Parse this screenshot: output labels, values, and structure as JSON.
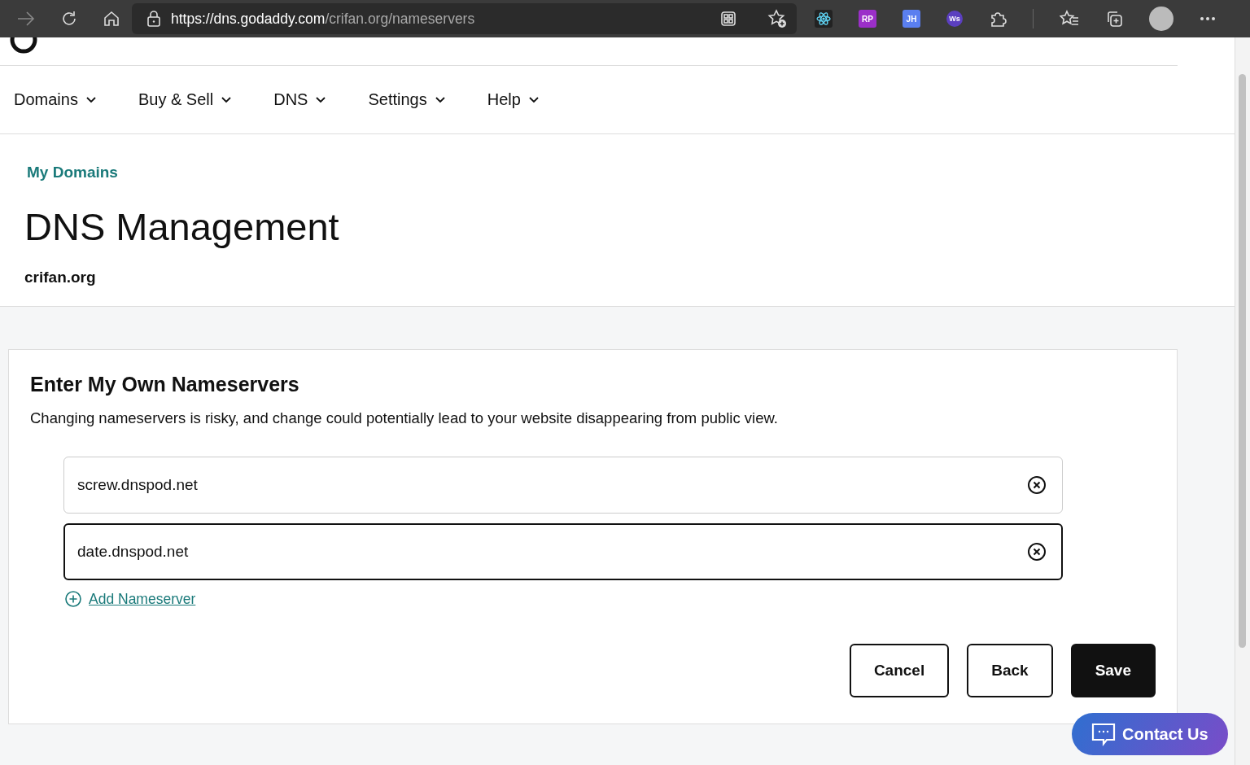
{
  "browser": {
    "url_host": "https://dns.godaddy.com",
    "url_path": "/crifan.org/nameservers",
    "extensions": [
      {
        "kind": "react"
      },
      {
        "kind": "badge",
        "label": "RP",
        "color": "#9b2fc9"
      },
      {
        "kind": "badge",
        "label": "JH",
        "color": "#5a7ff0"
      },
      {
        "kind": "round",
        "label": "Ws",
        "color": "#5b3fc0"
      }
    ]
  },
  "nav": {
    "items": [
      {
        "label": "Domains"
      },
      {
        "label": "Buy & Sell"
      },
      {
        "label": "DNS"
      },
      {
        "label": "Settings"
      },
      {
        "label": "Help"
      }
    ]
  },
  "header": {
    "breadcrumb": "My Domains",
    "title": "DNS Management",
    "domain": "crifan.org"
  },
  "card": {
    "title": "Enter My Own Nameservers",
    "description": "Changing nameservers is risky, and change could potentially lead to your website disappearing from public view.",
    "nameservers": [
      {
        "value": "screw.dnspod.net",
        "focused": false
      },
      {
        "value": "date.dnspod.net",
        "focused": true
      }
    ],
    "add_link": "Add Nameserver",
    "buttons": [
      {
        "label": "Cancel",
        "kind": "secondary"
      },
      {
        "label": "Back",
        "kind": "secondary"
      },
      {
        "label": "Save",
        "kind": "primary"
      }
    ]
  },
  "contact": {
    "label": "Contact Us"
  }
}
